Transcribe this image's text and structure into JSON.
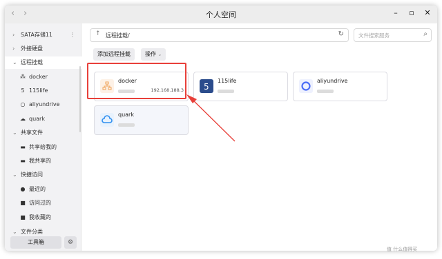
{
  "window": {
    "title": "个人空间",
    "back_icon": "chevron-left",
    "forward_icon": "chevron-right",
    "minimize_icon": "minimize",
    "maximize_icon": "maximize",
    "close_icon": "close"
  },
  "sidebar": {
    "storage_label": "SATA存储11",
    "external_label": "外接硬盘",
    "remote_label": "远程挂载",
    "remote_items": [
      {
        "label": "docker",
        "icon": "tree-icon"
      },
      {
        "label": "115life",
        "icon": "115-icon"
      },
      {
        "label": "aliyundrive",
        "icon": "circle-icon"
      },
      {
        "label": "quark",
        "icon": "cloud-icon"
      }
    ],
    "shared_label": "共享文件",
    "shared_items": [
      {
        "label": "共享给我的",
        "icon": "share-icon"
      },
      {
        "label": "我共享的",
        "icon": "share-icon"
      }
    ],
    "quick_label": "快捷访问",
    "quick_items": [
      {
        "label": "最近的",
        "icon": "clock-icon"
      },
      {
        "label": "访问过的",
        "icon": "folder-icon"
      },
      {
        "label": "我收藏的",
        "icon": "star-folder-icon"
      }
    ],
    "category_label": "文件分类",
    "toolbox_label": "工具箱"
  },
  "main": {
    "path": "远程挂载/",
    "search_placeholder": "文件搜索服务",
    "add_mount_label": "添加远程挂载",
    "operations_label": "操作",
    "operations_chevron": "⌄",
    "cards": [
      {
        "name": "docker",
        "ip": "192.168.188.3",
        "icon": "docker-network-icon",
        "icon_color": "#f0a35a"
      },
      {
        "name": "115life",
        "ip": "",
        "icon": "115-logo-icon",
        "icon_color": "#2b4c8c"
      },
      {
        "name": "aliyundrive",
        "ip": "",
        "icon": "aliyundrive-logo-icon",
        "icon_color": "#4a6cf7"
      },
      {
        "name": "quark",
        "ip": "",
        "icon": "quark-cloud-icon",
        "icon_color": "#2f8ff0"
      }
    ]
  },
  "annotation_color": "#e8403a",
  "watermark": "值 什么值得买"
}
